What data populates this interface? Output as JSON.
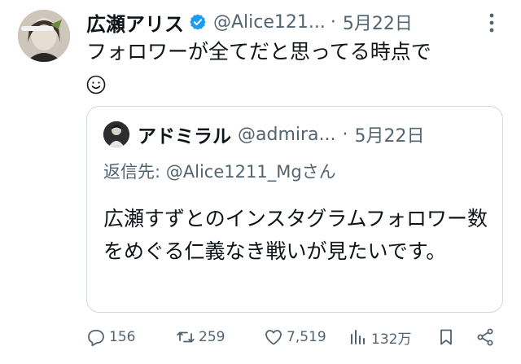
{
  "tweet": {
    "author_name": "広瀬アリス",
    "handle": "@Alice121...",
    "separator": "·",
    "date": "5月22日",
    "text_line1": "フォロワーが全てだと思ってる時点で",
    "emoji": "smiling-face-icon"
  },
  "quote": {
    "author_name": "アドミラル",
    "handle": "@admira...",
    "separator": "·",
    "date": "5月22日",
    "reply_prefix": "返信先: ",
    "reply_to": "@Alice1211_Mgさん",
    "body": "広瀬すずとのインスタグラムフォロワー数をめぐる仁義なき戦いが見たいです。"
  },
  "actions": {
    "replies": "156",
    "retweets": "259",
    "likes": "7,519",
    "views": "132万"
  },
  "colors": {
    "text": "#0f1419",
    "secondary": "#536471",
    "verified": "#1d9bf0",
    "border": "#cfd9de"
  }
}
